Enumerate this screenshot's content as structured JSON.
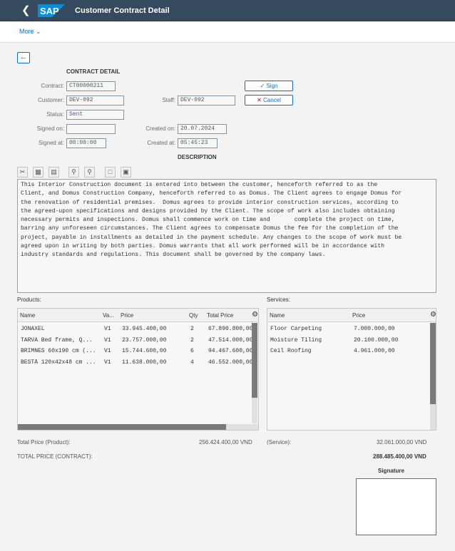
{
  "shell": {
    "logo_text": "SAP",
    "title": "Customer Contract Detail"
  },
  "subbar": {
    "more_label": "More"
  },
  "section_title": "CONTRACT DETAIL",
  "fields": {
    "contract_label": "Contract:",
    "contract_value": "CT00000211",
    "customer_label": "Customer:",
    "customer_value": "DEV-092",
    "staff_label": "Staff:",
    "staff_value": "DEV-092",
    "status_label": "Status:",
    "status_value": "Sent",
    "signed_on_label": "Signed on:",
    "signed_on_value": "",
    "created_on_label": "Created on:",
    "created_on_value": "20.07.2024",
    "signed_at_label": "Signed at:",
    "signed_at_value": "00:00:00",
    "created_at_label": "Created at:",
    "created_at_value": "05:45:23"
  },
  "buttons": {
    "sign_label": "Sign",
    "cancel_label": "Cancel"
  },
  "description_title": "DESCRIPTION",
  "description_text": "This Interior Construction document is entered into between the customer, henceforth referred to as the\nClient, and Domus Construction Company, henceforth referred to as Domus. The Client agrees to engage Domus for\nthe renovation of residential premises.  Domus agrees to provide interior construction services, according to\nthe agreed-upon specifications and designs provided by the Client. The scope of work also includes obtaining\nnecessary permits and inspections. Domus shall commence work on time and       complete the project on time,\nbarring any unforeseen circumstances. The Client agrees to compensate Domus the fee for the completion of the\nproject, payable in installments as detailed in the payment schedule. Any changes to the scope of work must be\nagreed upon in writing by both parties. Domus warrants that all work performed will be in accordance with\nindustry standards and regulations. This document shall be governed by the company laws.",
  "products": {
    "title": "Products:",
    "columns": [
      "Name",
      "Va...",
      "Price",
      "Qty",
      "Total Price"
    ],
    "rows": [
      [
        "JONAXEL",
        "V1",
        "33.945.400,00",
        "2",
        "67.890.800,00"
      ],
      [
        "TARVA Bed frame,  Q...",
        "V1",
        "23.757.000,00",
        "2",
        "47.514.000,00"
      ],
      [
        "BRIMNES 60x190 cm (...",
        "V1",
        "15.744.600,00",
        "6",
        "94.467.600,00"
      ],
      [
        "BESTÅ 120x42x48 cm ...",
        "V1",
        "11.638.000,00",
        "4",
        "46.552.000,00"
      ]
    ]
  },
  "services": {
    "title": "Services:",
    "columns": [
      "Name",
      "Price"
    ],
    "rows": [
      [
        "Floor Carpeting",
        "7.000.000,00"
      ],
      [
        "Moisture Tiling",
        "20.100.000,00"
      ],
      [
        "Ceil Roofing",
        "4.961.000,00"
      ]
    ]
  },
  "totals": {
    "product_label": "Total Price (Product):",
    "product_value": "256.424.400,00 VND",
    "service_label": "(Service):",
    "service_value": "32.061.000,00 VND",
    "contract_label": "TOTAL PRICE (CONTRACT):",
    "contract_value": "288.485.400,00 VND"
  },
  "signature_label": "Signature"
}
